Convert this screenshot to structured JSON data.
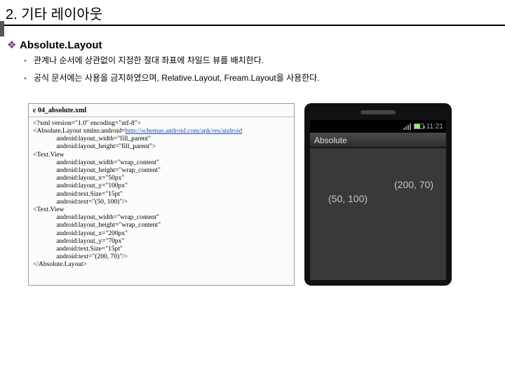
{
  "page": {
    "title": "2. 기타 레이아웃"
  },
  "section": {
    "heading": "Absolute.Layout",
    "bullets": [
      "관계나 순서에 상관없이 지정한 절대 좌표에 차일드 뷰를 배치한다.",
      "공식 문서에는 사용을 금지하였으며, Relative.Layout, Fream.Layout을 사용한다."
    ]
  },
  "codecard": {
    "filename": "c 04_absolute.xml",
    "lines": [
      "<?xml version=\"1.0\" encoding=\"utf-8\">",
      "<Absolute.Layout xmlns:android=",
      "URL::http://schemas.android.com/apk/res/android",
      "              android:layout_width=\"fill_parent\"",
      "              android:layout_height=\"fill_parent\">",
      "<Text.View",
      "              android:layout_width=\"wrap_content\"",
      "              android:layout_height=\"wrap_content\"",
      "              android:layout_x=\"50px\"",
      "              android:layout_y=\"100px\"",
      "              android:text.Size=\"15pt\"",
      "              android:text=\"(50, 100)\"/>",
      "<Text.View",
      "              android:layout_width=\"wrap_content\"",
      "              android:layout_height=\"wrap_content\"",
      "              android:layout_x=\"200px\"",
      "              android:layout_y=\"70px\"",
      "              android:text.Size=\"15pt\"",
      "              android:text=\"(200, 70)\"/>",
      "</Absolute.Layout>"
    ]
  },
  "phone": {
    "status_time": "11:21",
    "app_title": "Absolute",
    "labels": {
      "a": "(50, 100)",
      "b": "(200, 70)"
    }
  }
}
